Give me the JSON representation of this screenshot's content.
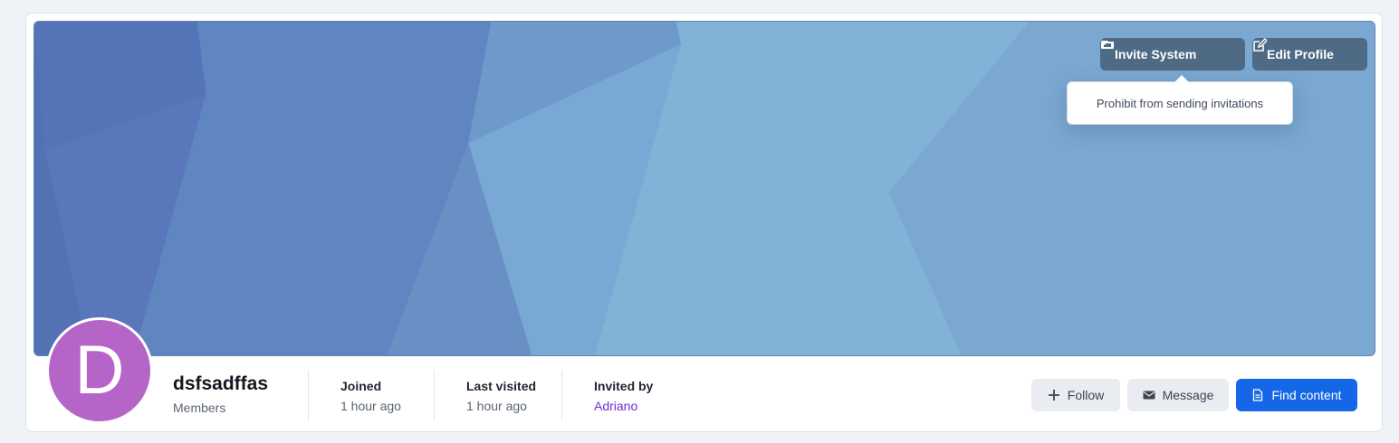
{
  "profile": {
    "avatar_letter": "D",
    "username": "dsfsadffas",
    "usergroup": "Members",
    "avatar_color": "#b565c8"
  },
  "header_buttons": {
    "invite_label": "Invite System",
    "edit_label": "Edit Profile"
  },
  "invite_menu": {
    "items": [
      {
        "label": "Prohibit from sending invitations"
      }
    ]
  },
  "stats": [
    {
      "label": "Joined",
      "value": "1 hour ago"
    },
    {
      "label": "Last visited",
      "value": "1 hour ago"
    },
    {
      "label": "Invited by",
      "value": "Adriano"
    }
  ],
  "actions": {
    "follow_label": "Follow",
    "message_label": "Message",
    "find_content_label": "Find content"
  },
  "icons": {
    "invite": "ticket-icon",
    "caret": "caret-down-icon",
    "edit": "edit-icon",
    "follow": "plus-icon",
    "message": "envelope-icon",
    "find": "document-icon"
  },
  "colors": {
    "primary": "#1467e6",
    "header_button": "#4e6a84",
    "link": "#6f2fd0"
  }
}
